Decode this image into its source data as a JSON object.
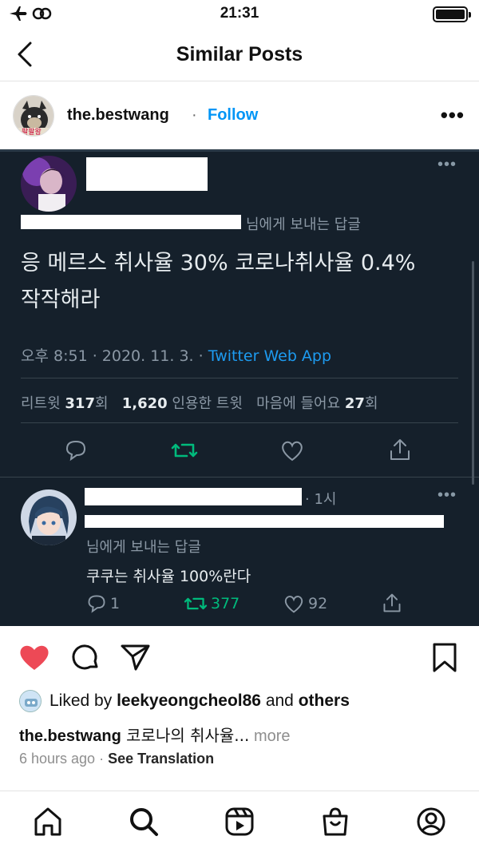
{
  "status_bar": {
    "time": "21:31"
  },
  "header": {
    "title": "Similar Posts"
  },
  "post": {
    "username": "the.bestwang",
    "separator": "·",
    "follow_label": "Follow",
    "avatar_label": "팔팔왕"
  },
  "tweet": {
    "reply_to_suffix": "님에게 보내는 답글",
    "text_line1": "응 메르스 취사율 30% 코로나취사율 0.4%",
    "text_line2": "작작해라",
    "meta_time": "오후 8:51 · 2020. 11. 3. · ",
    "meta_source": "Twitter Web App",
    "stats": {
      "retweet_label": "리트윗 ",
      "retweet_count": "317",
      "retweet_unit": "회",
      "quote_count": "1,620",
      "quote_label": " 인용한 트윗",
      "like_label": "마음에 들어요 ",
      "like_count": "27",
      "like_unit": "회"
    }
  },
  "reply": {
    "time": "· 1시",
    "reply_to_suffix": "님에게 보내는 답글",
    "text": "쿠쿠는 취사율 100%란다",
    "reply_count": "1",
    "retweet_count": "377",
    "like_count": "92"
  },
  "likes": {
    "prefix": "Liked by ",
    "user": "leekyeongcheol86",
    "and": " and ",
    "others": "others"
  },
  "caption": {
    "username": "the.bestwang",
    "text": " 코로나의 취사율...",
    "more": " more"
  },
  "timeline": {
    "age": "6 hours ago",
    "separator": " · ",
    "translate": "See Translation"
  },
  "colors": {
    "tweet_bg": "#15202b",
    "twitter_blue": "#1d9bf0",
    "retweet_green": "#00ba7c",
    "like_red": "#ed4956",
    "follow_blue": "#0095f6"
  }
}
